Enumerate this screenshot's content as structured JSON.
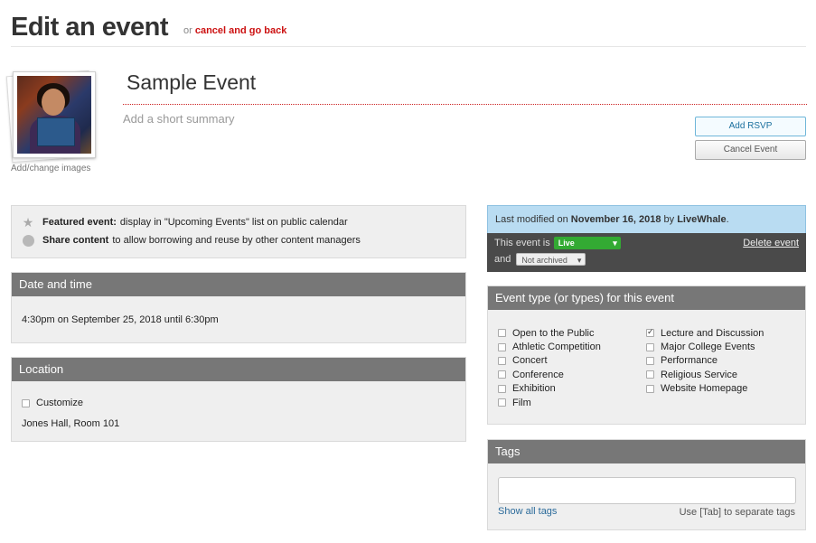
{
  "header": {
    "title": "Edit an event",
    "back_prefix": "or",
    "back_link": "cancel and go back"
  },
  "image": {
    "caption": "Add/change images"
  },
  "event": {
    "title": "Sample Event",
    "summary_placeholder": "Add a short summary"
  },
  "actions": {
    "add_rsvp": "Add RSVP",
    "cancel_event": "Cancel Event"
  },
  "options": {
    "featured_label": "Featured event:",
    "featured_text": "display in \"Upcoming Events\" list on public calendar",
    "share_label": "Share content",
    "share_text": "to allow borrowing and reuse by other content managers"
  },
  "date_time": {
    "heading": "Date and time",
    "value": "4:30pm on September 25, 2018 until 6:30pm"
  },
  "location": {
    "heading": "Location",
    "customize_label": "Customize",
    "value": "Jones Hall, Room 101"
  },
  "status": {
    "modified_prefix": "Last modified on",
    "modified_date": "November 16, 2018",
    "modified_by_prefix": "by",
    "modified_by": "LiveWhale",
    "period": ".",
    "state_prefix": "This event is",
    "state_value": "Live",
    "and_label": "and",
    "archive_value": "Not archived",
    "delete_label": "Delete event",
    "colors": {
      "live": "#33aa33",
      "modified_bg": "#b9dcf2"
    }
  },
  "event_types": {
    "heading": "Event type (or types) for this event",
    "column1": [
      {
        "label": "Open to the Public",
        "checked": false
      },
      {
        "label": "Athletic Competition",
        "checked": false
      },
      {
        "label": "Concert",
        "checked": false
      },
      {
        "label": "Conference",
        "checked": false
      },
      {
        "label": "Exhibition",
        "checked": false
      },
      {
        "label": "Film",
        "checked": false
      }
    ],
    "column2": [
      {
        "label": "Lecture and Discussion",
        "checked": true
      },
      {
        "label": "Major College Events",
        "checked": false
      },
      {
        "label": "Performance",
        "checked": false
      },
      {
        "label": "Religious Service",
        "checked": false
      },
      {
        "label": "Website Homepage",
        "checked": false
      }
    ]
  },
  "tags": {
    "heading": "Tags",
    "input_value": "",
    "show_all": "Show all tags",
    "hint": "Use [Tab] to separate tags"
  }
}
